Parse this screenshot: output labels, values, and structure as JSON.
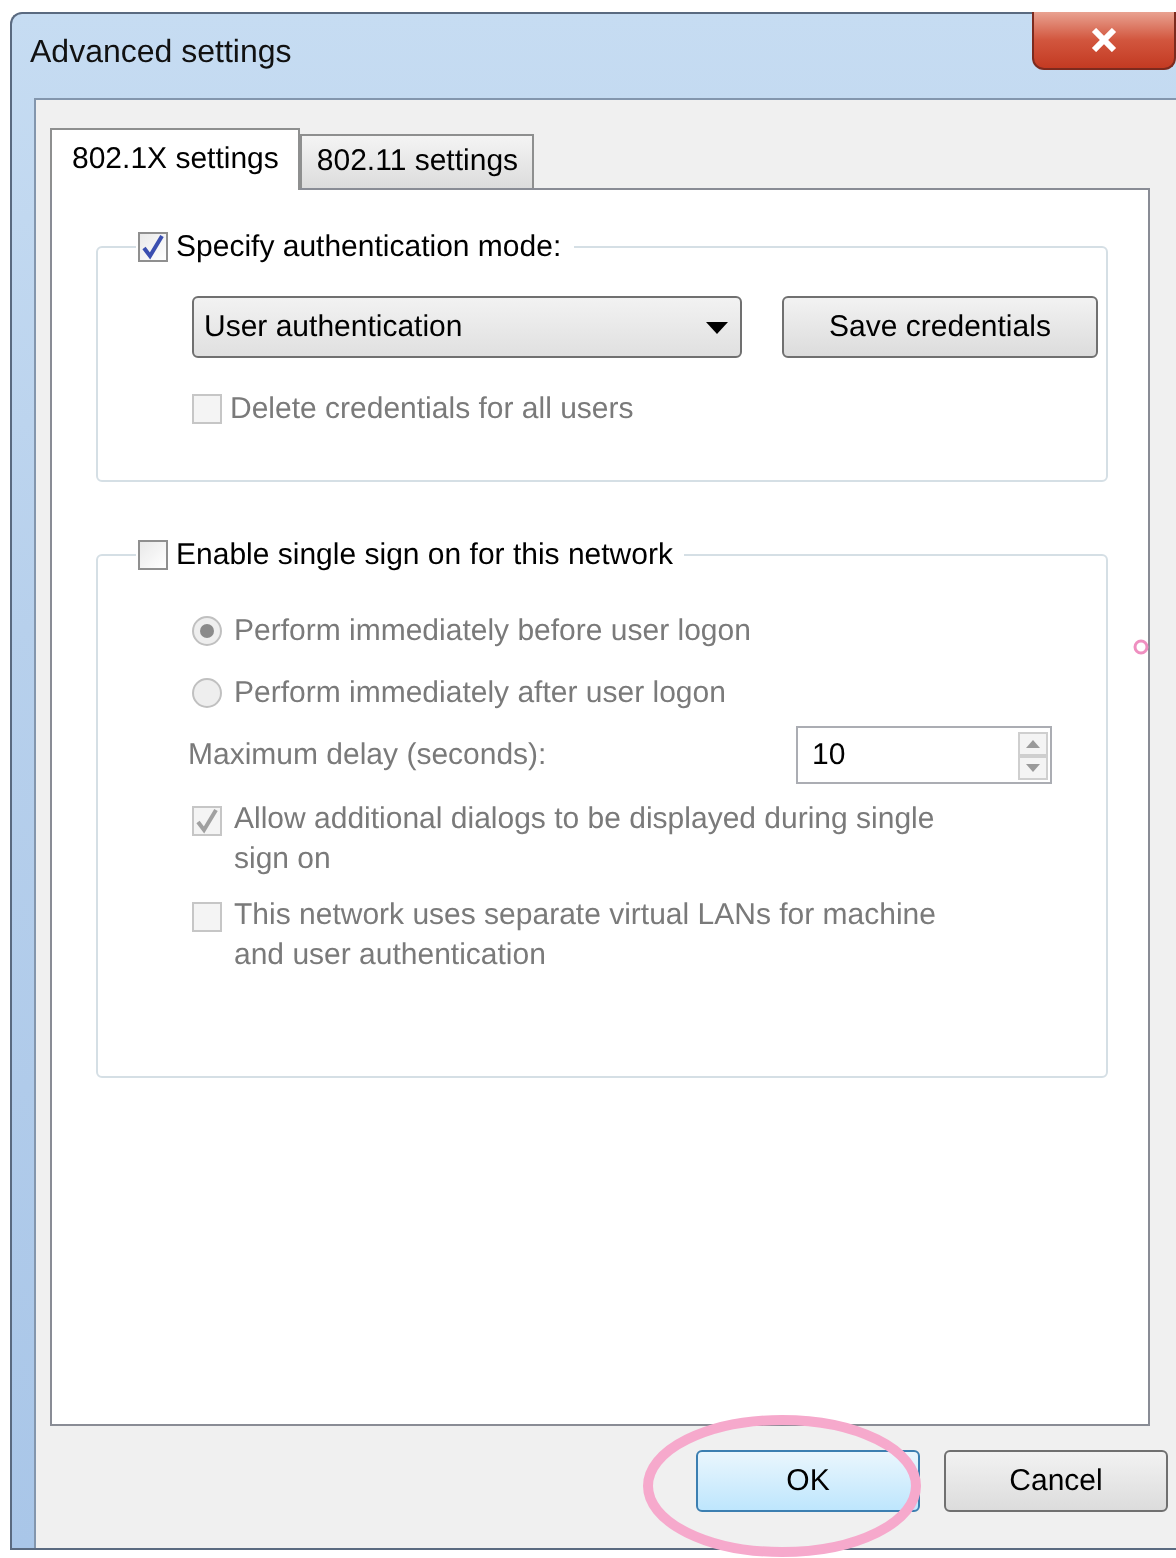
{
  "window": {
    "title": "Advanced settings"
  },
  "tabs": [
    {
      "label": "802.1X settings",
      "selected": true
    },
    {
      "label": "802.11 settings",
      "selected": false
    }
  ],
  "auth_group": {
    "checkbox": {
      "label": "Specify authentication mode:",
      "checked": true
    },
    "mode": {
      "value": "User authentication"
    },
    "save_button": "Save credentials",
    "delete_checkbox": {
      "label": "Delete credentials for all users",
      "checked": false,
      "disabled": true
    }
  },
  "sso_group": {
    "checkbox": {
      "label": "Enable single sign on for this network",
      "checked": false
    },
    "options": [
      {
        "kind": "radio",
        "label": "Perform immediately before user logon",
        "selected": true,
        "disabled": true
      },
      {
        "kind": "radio",
        "label": "Perform immediately after user logon",
        "selected": false,
        "disabled": true
      },
      {
        "kind": "spinner",
        "label": "Maximum delay (seconds):",
        "value": "10",
        "disabled": true
      },
      {
        "kind": "checkbox",
        "label": "Allow additional dialogs to be displayed during single sign on",
        "checked": true,
        "disabled": true
      },
      {
        "kind": "checkbox",
        "label": "This network uses separate virtual LANs for machine and user authentication",
        "checked": false,
        "disabled": true
      }
    ]
  },
  "buttons": [
    {
      "label": "OK",
      "default": true
    },
    {
      "label": "Cancel",
      "default": false
    }
  ],
  "annotations": {
    "ellipse_around_ok": true,
    "small_circle": true
  }
}
